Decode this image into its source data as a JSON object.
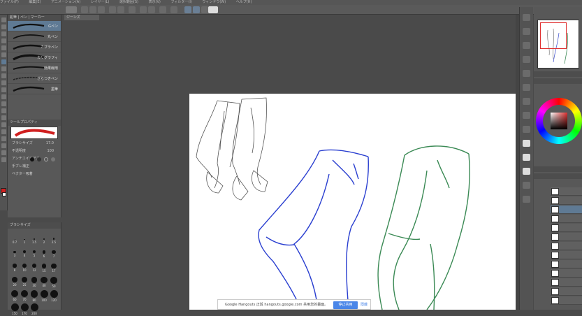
{
  "menu": [
    "ファイル(F)",
    "編集(E)",
    "アニメーション(A)",
    "レイヤー(L)",
    "選択範囲(S)",
    "表示(V)",
    "フィルター(I)",
    "ウィンドウ(W)",
    "ヘルプ(H)"
  ],
  "document": {
    "tab": "ジーンズ"
  },
  "subtool": {
    "tabs": "鉛筆 | ペン | マーカー",
    "brushes": [
      {
        "label": "Gペン",
        "selected": true
      },
      {
        "label": "丸ペン",
        "selected": false
      },
      {
        "label": "カブラペン",
        "selected": false
      },
      {
        "label": "カリグラフィ",
        "selected": false
      },
      {
        "label": "効果線用",
        "selected": false
      },
      {
        "label": "ざらつきペン",
        "selected": false
      },
      {
        "label": "墨筆",
        "selected": false
      }
    ]
  },
  "toolprop": {
    "title": "ツールプロパティ",
    "size_label": "ブラシサイズ",
    "size_value": "17.0",
    "opacity_label": "不透明度",
    "opacity_value": "100",
    "aa_label": "アンチエイリアス",
    "stabilize_label": "手ブレ補正",
    "vector_label": "ベクター吸着"
  },
  "brushsize": {
    "title": "ブラシサイズ",
    "values": [
      "0.7",
      "1",
      "1.5",
      "2",
      "2.5",
      "3",
      "4",
      "5",
      "6",
      "7",
      "8",
      "10",
      "12",
      "15",
      "17",
      "20",
      "25",
      "30",
      "40",
      "50",
      "60",
      "70",
      "80",
      "100",
      "120",
      "150",
      "170",
      "200"
    ]
  },
  "toast": {
    "message": "Google Hangouts 正與 hangouts.google.com 共用您的畫面。",
    "stop_label": "停止共用",
    "hide_label": "隱藏"
  },
  "colors": {
    "accent_select": "#5f7a94",
    "pencil_sketch": "#555555",
    "blue_line": "#2a3fd0",
    "green_line": "#3b8a55"
  }
}
